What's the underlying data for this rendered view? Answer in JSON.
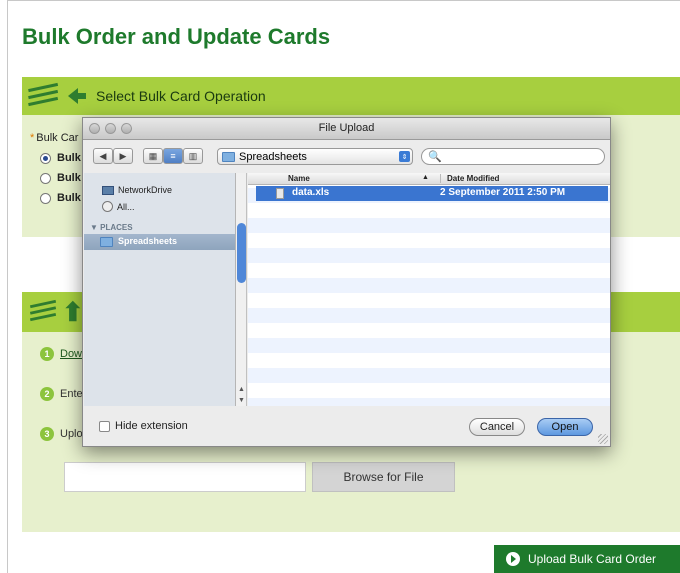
{
  "page": {
    "title": "Bulk Order and Update Cards"
  },
  "section1": {
    "label": "Select Bulk Card Operation",
    "field_label": "Bulk Car",
    "required_mark": "*",
    "options": [
      "Bulk",
      "Bulk",
      "Bulk"
    ]
  },
  "section2": {
    "steps": [
      {
        "num": "1",
        "text": "Dow"
      },
      {
        "num": "2",
        "text": "Ente"
      },
      {
        "num": "3",
        "text": "Uplo"
      }
    ],
    "browse_label": "Browse for File",
    "file_value": ""
  },
  "upload_button": {
    "label": "Upload Bulk Card Order"
  },
  "dialog": {
    "title": "File Upload",
    "location": "Spreadsheets",
    "search_value": "",
    "sidebar": {
      "devices": [
        {
          "label": "NetworkDrive",
          "icon": "monitor-icon"
        },
        {
          "label": "All...",
          "icon": "globe-icon"
        }
      ],
      "places_heading": "PLACES",
      "places": [
        {
          "label": "Spreadsheets",
          "icon": "folder-icon"
        }
      ]
    },
    "columns": {
      "name": "Name",
      "date": "Date Modified"
    },
    "files": [
      {
        "name": "data.xls",
        "date": "2 September 2011 2:50 PM"
      }
    ],
    "hide_extension_label": "Hide extension",
    "cancel_label": "Cancel",
    "open_label": "Open"
  },
  "colors": {
    "brand_green": "#1e7a2c",
    "bar_green": "#a7cf3f",
    "panel_green": "#e7f0cd",
    "selection_blue": "#3a75d0"
  }
}
